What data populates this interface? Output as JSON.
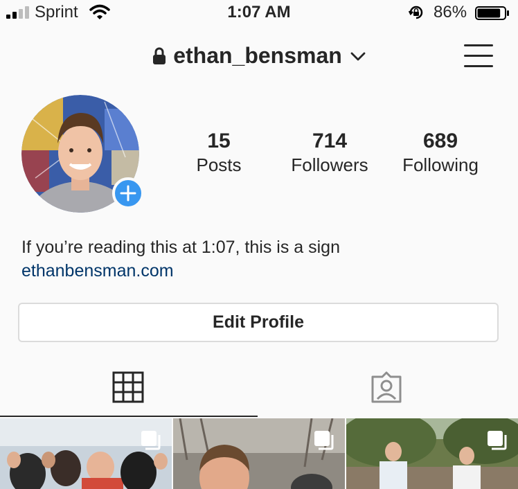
{
  "status_bar": {
    "carrier": "Sprint",
    "time": "1:07 AM",
    "battery_percent": "86%",
    "battery_level": 0.86
  },
  "header": {
    "username": "ethan_bensman",
    "icons": [
      "lock-icon",
      "chevron-down-icon",
      "menu-icon"
    ]
  },
  "profile": {
    "stats": [
      {
        "value": "15",
        "label": "Posts"
      },
      {
        "value": "714",
        "label": "Followers"
      },
      {
        "value": "689",
        "label": "Following"
      }
    ],
    "bio": "If you’re reading this at 1:07, this is a sign",
    "website": "ethanbensman.com",
    "edit_button": "Edit Profile"
  },
  "tabs": [
    {
      "name": "grid",
      "icon": "grid-icon",
      "active": true
    },
    {
      "name": "tagged",
      "icon": "tagged-user-icon",
      "active": false
    }
  ],
  "colors": {
    "accent_blue": "#3897f0",
    "link": "#003569",
    "text": "#262626",
    "background": "#fafafa",
    "border": "#dbdbdb"
  }
}
